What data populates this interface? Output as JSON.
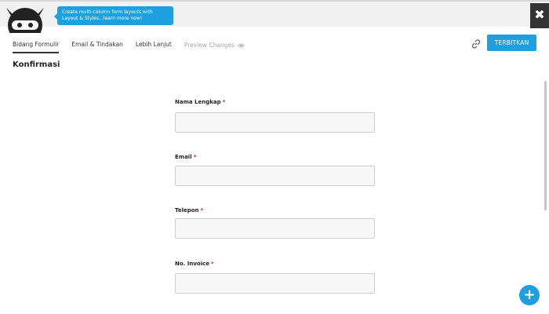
{
  "header": {
    "tooltip_text": "Create multi-column form layouts with Layout & Styles...learn more now!",
    "close_symbol": "✖",
    "brand_color": "#1ea0e0"
  },
  "tabs": [
    {
      "label": "Bidang Formulir",
      "active": true
    },
    {
      "label": "Email & Tindakan",
      "active": false
    },
    {
      "label": "Lebih Lanjut",
      "active": false
    },
    {
      "label": "Preview Changes",
      "active": false,
      "muted": true,
      "icon": "eye-icon"
    }
  ],
  "toolbar": {
    "link_icon": "link-icon",
    "publish_label": "TERBITKAN"
  },
  "page": {
    "title": "Konfirmasi"
  },
  "form": {
    "required_marker": "*",
    "fields": [
      {
        "label": "Nama Lengkap",
        "value": "",
        "placeholder": ""
      },
      {
        "label": "Email",
        "value": "",
        "placeholder": ""
      },
      {
        "label": "Telepon",
        "value": "",
        "placeholder": ""
      },
      {
        "label": "No. Invoice",
        "value": "",
        "placeholder": ""
      }
    ]
  },
  "fab": {
    "symbol": "+"
  }
}
